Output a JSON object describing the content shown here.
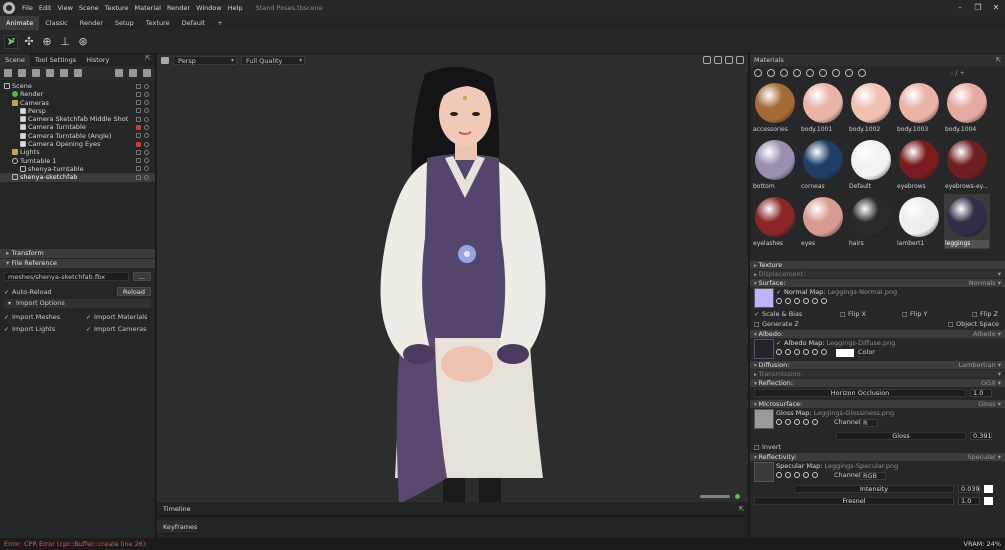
{
  "menubar": {
    "items": [
      "File",
      "Edit",
      "View",
      "Scene",
      "Texture",
      "Material",
      "Render",
      "Window",
      "Help"
    ],
    "doc_title": "Stand Poses.tbscene"
  },
  "workspace_tabs": [
    "Animate",
    "Classic",
    "Render",
    "Setup",
    "Texture",
    "Default",
    "+"
  ],
  "left_panel": {
    "tabs": [
      "Scene",
      "Tool Settings",
      "History"
    ],
    "tree": [
      {
        "label": "Scene",
        "depth": 0,
        "icon": "scene-icon"
      },
      {
        "label": "Render",
        "depth": 1,
        "icon": "render-icon"
      },
      {
        "label": "Cameras",
        "depth": 1,
        "icon": "folder-icon"
      },
      {
        "label": "Persp",
        "depth": 2,
        "icon": "camera-icon"
      },
      {
        "label": "Camera Sketchfab Middle Shot",
        "depth": 2,
        "icon": "camera-icon"
      },
      {
        "label": "Camera Turntable",
        "depth": 2,
        "icon": "camera-icon"
      },
      {
        "label": "Camera Turntable (Angle)",
        "depth": 2,
        "icon": "camera-icon"
      },
      {
        "label": "Camera Opening Eyes",
        "depth": 2,
        "icon": "camera-icon"
      },
      {
        "label": "Lights",
        "depth": 1,
        "icon": "folder-icon"
      },
      {
        "label": "Turntable 1",
        "depth": 1,
        "icon": "turntable-icon"
      },
      {
        "label": "shenya-turntable",
        "depth": 2,
        "icon": "mesh-icon"
      },
      {
        "label": "shenya-sketchfab",
        "depth": 1,
        "icon": "mesh-icon"
      }
    ],
    "sections": {
      "transform": "Transform",
      "file_reference": "File Reference"
    },
    "file_path": "meshes/shenya-sketchfab.fbx",
    "browse_label": "...",
    "auto_reload": "Auto-Reload",
    "reload_label": "Reload",
    "import_options": "Import Options",
    "import_meshes": "Import Meshes",
    "import_materials": "Import Materials",
    "import_lights": "Import Lights",
    "import_cameras": "Import Cameras"
  },
  "viewport": {
    "camera": "Persp",
    "quality": "Full Quality"
  },
  "timeline": {
    "timeline_label": "Timeline",
    "keyframes_label": "Keyframes"
  },
  "materials": {
    "title": "Materials",
    "nav": "- / +",
    "swatches": [
      {
        "name": "accessories",
        "color": "#a56a35"
      },
      {
        "name": "body.1001",
        "color": "#e8b4a6"
      },
      {
        "name": "body.1002",
        "color": "#f0c0b0"
      },
      {
        "name": "body.1003",
        "color": "#e9b3a5"
      },
      {
        "name": "body.1004",
        "color": "#e6a9a0"
      },
      {
        "name": "bottom",
        "color": "#9a8fb0"
      },
      {
        "name": "corneas",
        "color": "#1f3f66"
      },
      {
        "name": "Default",
        "color": "#f2f2f2"
      },
      {
        "name": "eyebrows",
        "color": "#7a1c1c"
      },
      {
        "name": "eyebrows-ey...",
        "color": "#6f1f20"
      },
      {
        "name": "eyelashes",
        "color": "#8a2626"
      },
      {
        "name": "eyes",
        "color": "#d79b92"
      },
      {
        "name": "hairs",
        "color": "#2a2a2a"
      },
      {
        "name": "lambert1",
        "color": "#eeeeee"
      },
      {
        "name": "leggings",
        "color": "#2f3045"
      }
    ]
  },
  "properties": {
    "texture": "Texture",
    "displacement": "Displacement:",
    "surface": "Surface:",
    "surface_mode": "Normals",
    "normal_map_label": "Normal Map:",
    "normal_map_file": "Leggings-Normal.png",
    "scale_bias": "Scale & Bias",
    "flip_x": "Flip X",
    "flip_y": "Flip Y",
    "flip_z": "Flip Z",
    "generate_z": "Generate Z",
    "object_space": "Object Space",
    "albedo": "Albedo:",
    "albedo_mode": "Albedo",
    "albedo_map_label": "Albedo Map:",
    "albedo_map_file": "Leggings-Diffuse.png",
    "color_label": "Color",
    "diffusion": "Diffusion:",
    "diffusion_mode": "Lambertian",
    "transmission": "Transmission:",
    "reflection": "Reflection:",
    "reflection_mode": "GGX",
    "horizon_occlusion": "Horizon Occlusion",
    "horizon_value": "1.0",
    "microsurface": "Microsurface:",
    "microsurface_mode": "Gloss",
    "gloss_map_label": "Gloss Map:",
    "gloss_map_file": "Leggings-Glossiness.png",
    "channel_label": "Channel",
    "gloss_channel": "R",
    "gloss_label": "Gloss",
    "gloss_value": "0.391",
    "invert_label": "Invert",
    "reflectivity": "Reflectivity:",
    "reflectivity_mode": "Specular",
    "specular_map_label": "Specular Map:",
    "specular_map_file": "Leggings-Specular.png",
    "specular_channel": "RGB",
    "intensity_label": "Intensity",
    "intensity_value": "0.039",
    "fresnel_label": "Fresnel",
    "fresnel_value": "1.0"
  },
  "statusbar": {
    "error": "Error: CPR Error (cpr::Buffer::create line 26):",
    "vram": "VRAM: 24%"
  }
}
